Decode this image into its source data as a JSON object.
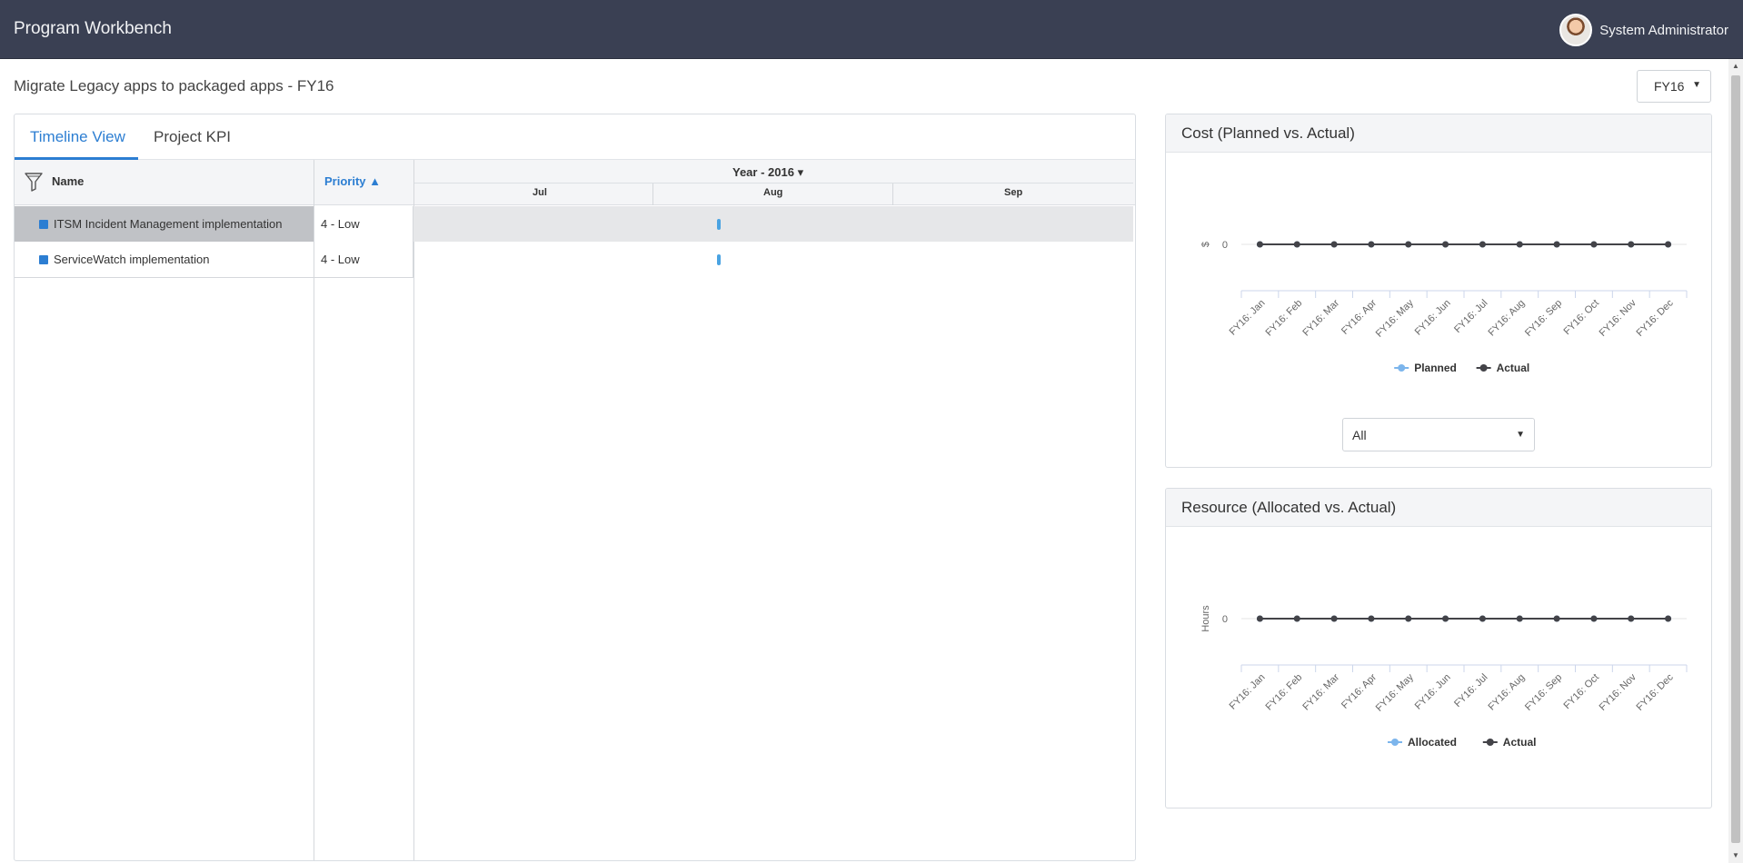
{
  "header": {
    "app_title": "Program Workbench",
    "user_name": "System Administrator"
  },
  "page": {
    "title": "Migrate Legacy apps to packaged apps - FY16",
    "fiscal_year_selected": "FY16"
  },
  "tabs": [
    {
      "label": "Timeline View",
      "active": true
    },
    {
      "label": "Project KPI",
      "active": false
    }
  ],
  "grid": {
    "columns": {
      "name": "Name",
      "priority": "Priority",
      "timeline": "Year - 2016"
    },
    "months": [
      "Jul",
      "Aug",
      "Sep"
    ],
    "rows": [
      {
        "name": "ITSM Incident Management implementation",
        "priority": "4 - Low",
        "selected": true
      },
      {
        "name": "ServiceWatch implementation",
        "priority": "4 - Low",
        "selected": false
      }
    ]
  },
  "colors": {
    "accent": "#2c7ed2",
    "header_bg": "#3a4053",
    "series_planned": "#7cb5ec",
    "series_actual": "#434348"
  },
  "cost_panel": {
    "title": "Cost (Planned vs. Actual)",
    "filter_value": "All"
  },
  "resource_panel": {
    "title": "Resource (Allocated vs. Actual)"
  },
  "chart_data": [
    {
      "type": "line",
      "title": "Cost (Planned vs. Actual)",
      "ylabel": "$",
      "y_ticks": [
        "0"
      ],
      "categories": [
        "FY16: Jan",
        "FY16: Feb",
        "FY16: Mar",
        "FY16: Apr",
        "FY16: May",
        "FY16: Jun",
        "FY16: Jul",
        "FY16: Aug",
        "FY16: Sep",
        "FY16: Oct",
        "FY16: Nov",
        "FY16: Dec"
      ],
      "series": [
        {
          "name": "Planned",
          "values": [
            0,
            0,
            0,
            0,
            0,
            0,
            0,
            0,
            0,
            0,
            0,
            0
          ],
          "color": "#7cb5ec"
        },
        {
          "name": "Actual",
          "values": [
            0,
            0,
            0,
            0,
            0,
            0,
            0,
            0,
            0,
            0,
            0,
            0
          ],
          "color": "#434348"
        }
      ],
      "legend": "bottom-center"
    },
    {
      "type": "line",
      "title": "Resource (Allocated vs. Actual)",
      "ylabel": "Hours",
      "y_ticks": [
        "0"
      ],
      "categories": [
        "FY16: Jan",
        "FY16: Feb",
        "FY16: Mar",
        "FY16: Apr",
        "FY16: May",
        "FY16: Jun",
        "FY16: Jul",
        "FY16: Aug",
        "FY16: Sep",
        "FY16: Oct",
        "FY16: Nov",
        "FY16: Dec"
      ],
      "series": [
        {
          "name": "Allocated",
          "values": [
            0,
            0,
            0,
            0,
            0,
            0,
            0,
            0,
            0,
            0,
            0,
            0
          ],
          "color": "#7cb5ec"
        },
        {
          "name": "Actual",
          "values": [
            0,
            0,
            0,
            0,
            0,
            0,
            0,
            0,
            0,
            0,
            0,
            0
          ],
          "color": "#434348"
        }
      ],
      "legend": "bottom-center"
    }
  ]
}
